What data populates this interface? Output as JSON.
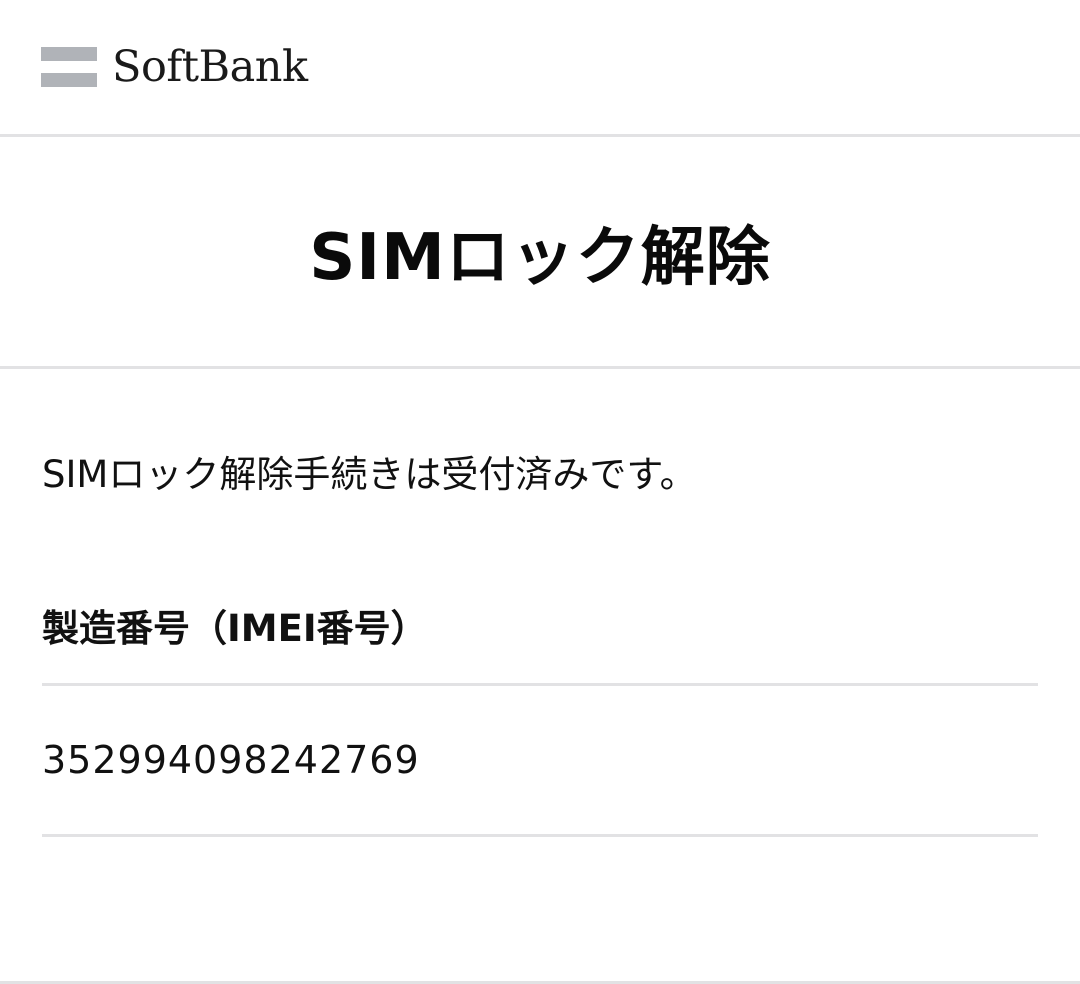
{
  "header": {
    "brand": "SoftBank"
  },
  "main": {
    "title": "SIMロック解除",
    "status_message": "SIMロック解除手続きは受付済みです。",
    "imei_label": "製造番号（IMEI番号）",
    "imei_value": "352994098242769"
  },
  "colors": {
    "logo_bars": "#b0b3b8",
    "divider": "#e2e2e4",
    "text": "#111111",
    "background": "#ffffff"
  }
}
